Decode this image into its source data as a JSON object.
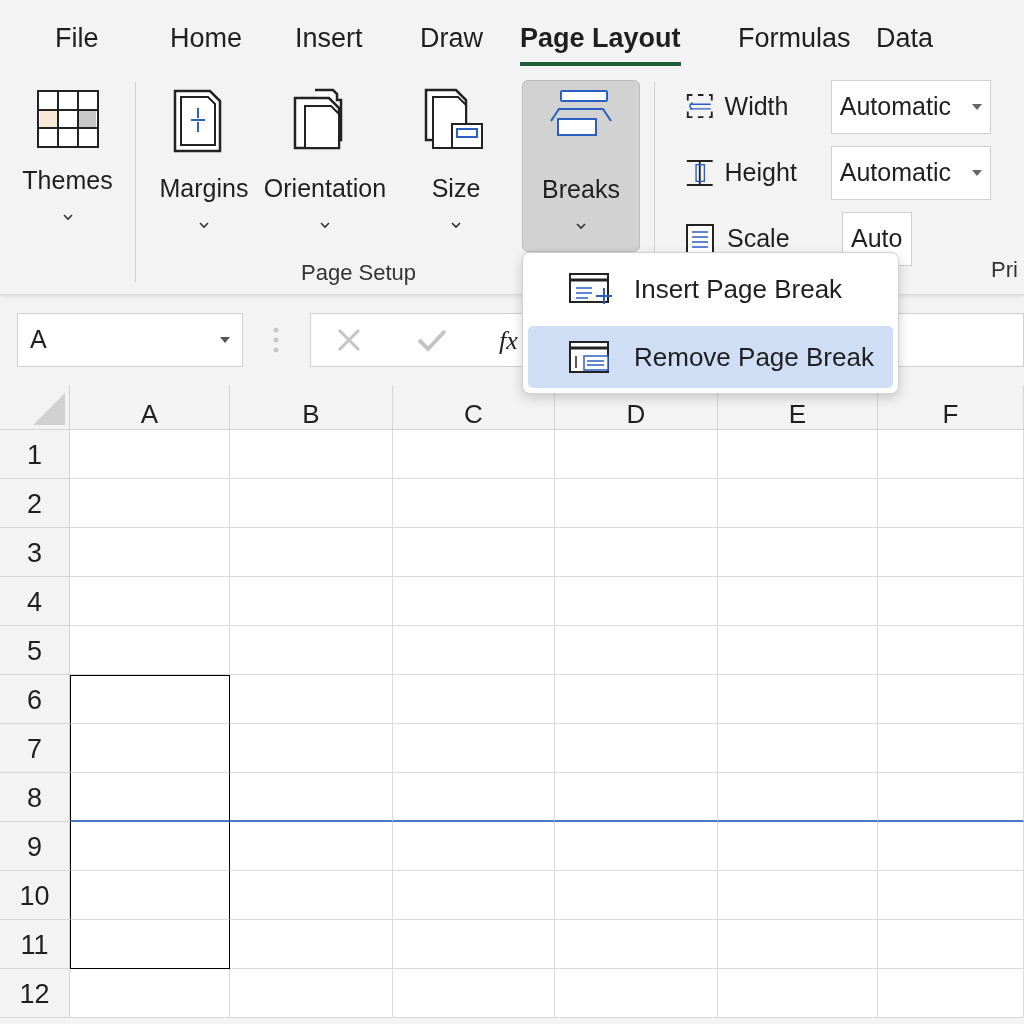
{
  "tabs": [
    {
      "label": "File",
      "selected": false
    },
    {
      "label": "Home",
      "selected": false
    },
    {
      "label": "Insert",
      "selected": false
    },
    {
      "label": "Draw",
      "selected": false
    },
    {
      "label": "Page Layout",
      "selected": true
    },
    {
      "label": "Formulas",
      "selected": false
    },
    {
      "label": "Data",
      "selected": false
    }
  ],
  "ribbon": {
    "themes": {
      "label": "Themes"
    },
    "page_setup": {
      "label": "Page Setup",
      "buttons": [
        {
          "label": "Margins",
          "kind": "margins",
          "pressed": false
        },
        {
          "label": "Orientation",
          "kind": "orientation",
          "pressed": false
        },
        {
          "label": "Size",
          "kind": "size",
          "pressed": false
        },
        {
          "label": "Breaks",
          "kind": "breaks",
          "pressed": true
        }
      ]
    },
    "scale_to_fit": {
      "rows": [
        {
          "label": "Width",
          "kind": "width",
          "value": "Automatic"
        },
        {
          "label": "Height",
          "kind": "height",
          "value": "Automatic"
        },
        {
          "label": "Scale",
          "kind": "scale",
          "value": "Auto"
        }
      ]
    },
    "next_group_label": "Pri"
  },
  "breaks_menu": {
    "items": [
      {
        "label": "Insert Page Break",
        "kind": "insert",
        "selected": false
      },
      {
        "label": "Remove Page Break",
        "kind": "remove",
        "selected": true
      }
    ]
  },
  "formula_bar": {
    "name_box": "A",
    "function_label": "fx"
  },
  "sheet": {
    "columns": [
      "A",
      "B",
      "C",
      "D",
      "E",
      "F"
    ],
    "rows": [
      {
        "label": "1",
        "page_break_below": false,
        "outlined": false
      },
      {
        "label": "2",
        "page_break_below": false,
        "outlined": false
      },
      {
        "label": "3",
        "page_break_below": false,
        "outlined": false
      },
      {
        "label": "4",
        "page_break_below": false,
        "outlined": false
      },
      {
        "label": "5",
        "page_break_below": false,
        "outlined": false
      },
      {
        "label": "6",
        "page_break_below": false,
        "outlined": true
      },
      {
        "label": "7",
        "page_break_below": false,
        "outlined": true
      },
      {
        "label": "8",
        "page_break_below": true,
        "outlined": true
      },
      {
        "label": "9",
        "page_break_below": false,
        "outlined": true
      },
      {
        "label": "10",
        "page_break_below": false,
        "outlined": true
      },
      {
        "label": "11",
        "page_break_below": false,
        "outlined": true
      },
      {
        "label": "12",
        "page_break_below": false,
        "outlined": false
      }
    ]
  }
}
